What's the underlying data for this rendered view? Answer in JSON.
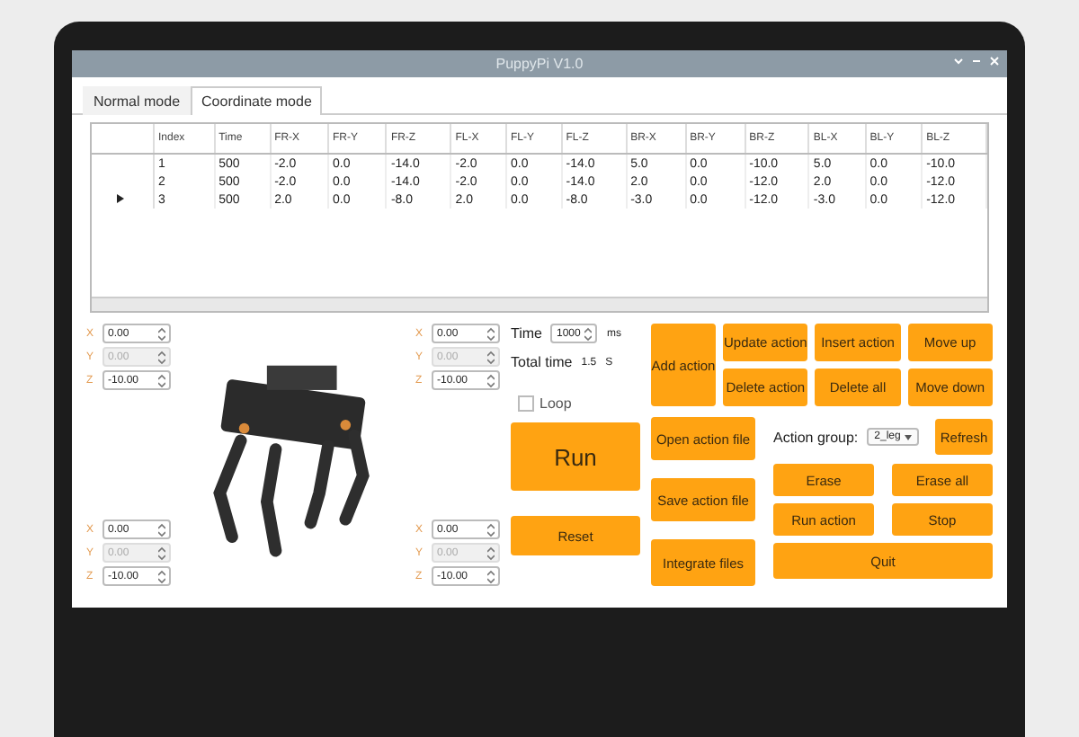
{
  "window": {
    "title": "PuppyPi V1.0"
  },
  "tabs": [
    {
      "label": "Normal mode",
      "selected": false
    },
    {
      "label": "Coordinate mode",
      "selected": true
    }
  ],
  "table": {
    "columns": [
      "Index",
      "Time",
      "FR-X",
      "FR-Y",
      "FR-Z",
      "FL-X",
      "FL-Y",
      "FL-Z",
      "BR-X",
      "BR-Y",
      "BR-Z",
      "BL-X",
      "BL-Y",
      "BL-Z"
    ],
    "rows": [
      {
        "selected": false,
        "cells": [
          "1",
          "500",
          "-2.0",
          "0.0",
          "-14.0",
          "-2.0",
          "0.0",
          "-14.0",
          "5.0",
          "0.0",
          "-10.0",
          "5.0",
          "0.0",
          "-10.0"
        ]
      },
      {
        "selected": false,
        "cells": [
          "2",
          "500",
          "-2.0",
          "0.0",
          "-14.0",
          "-2.0",
          "0.0",
          "-14.0",
          "2.0",
          "0.0",
          "-12.0",
          "2.0",
          "0.0",
          "-12.0"
        ]
      },
      {
        "selected": true,
        "cells": [
          "3",
          "500",
          "2.0",
          "0.0",
          "-8.0",
          "2.0",
          "0.0",
          "-8.0",
          "-3.0",
          "0.0",
          "-12.0",
          "-3.0",
          "0.0",
          "-12.0"
        ]
      }
    ]
  },
  "legs": [
    {
      "fields": [
        {
          "axis": "X",
          "value": "0.00",
          "disabled": false
        },
        {
          "axis": "Y",
          "value": "0.00",
          "disabled": true
        },
        {
          "axis": "Z",
          "value": "-10.00",
          "disabled": false
        }
      ]
    },
    {
      "fields": [
        {
          "axis": "X",
          "value": "0.00",
          "disabled": false
        },
        {
          "axis": "Y",
          "value": "0.00",
          "disabled": true
        },
        {
          "axis": "Z",
          "value": "-10.00",
          "disabled": false
        }
      ]
    },
    {
      "fields": [
        {
          "axis": "X",
          "value": "0.00",
          "disabled": false
        },
        {
          "axis": "Y",
          "value": "0.00",
          "disabled": true
        },
        {
          "axis": "Z",
          "value": "-10.00",
          "disabled": false
        }
      ]
    },
    {
      "fields": [
        {
          "axis": "X",
          "value": "0.00",
          "disabled": false
        },
        {
          "axis": "Y",
          "value": "0.00",
          "disabled": true
        },
        {
          "axis": "Z",
          "value": "-10.00",
          "disabled": false
        }
      ]
    }
  ],
  "time": {
    "label": "Time",
    "value": "1000",
    "unit": "ms"
  },
  "total_time": {
    "label": "Total time",
    "value": "1.5",
    "unit": "S"
  },
  "loop": {
    "label": "Loop",
    "checked": false
  },
  "run_button": "Run",
  "reset_button": "Reset",
  "add_action": "Add action",
  "edit_buttons": [
    "Update action",
    "Insert action",
    "Move up",
    "Delete action",
    "Delete all",
    "Move down"
  ],
  "file_buttons": [
    "Open action file",
    "Save action file",
    "Integrate files"
  ],
  "action_group": {
    "label": "Action group:",
    "value": "2_leg"
  },
  "refresh_button": "Refresh",
  "group_buttons": [
    "Erase",
    "Erase all",
    "Run action",
    "Stop"
  ],
  "quit_button": "Quit"
}
